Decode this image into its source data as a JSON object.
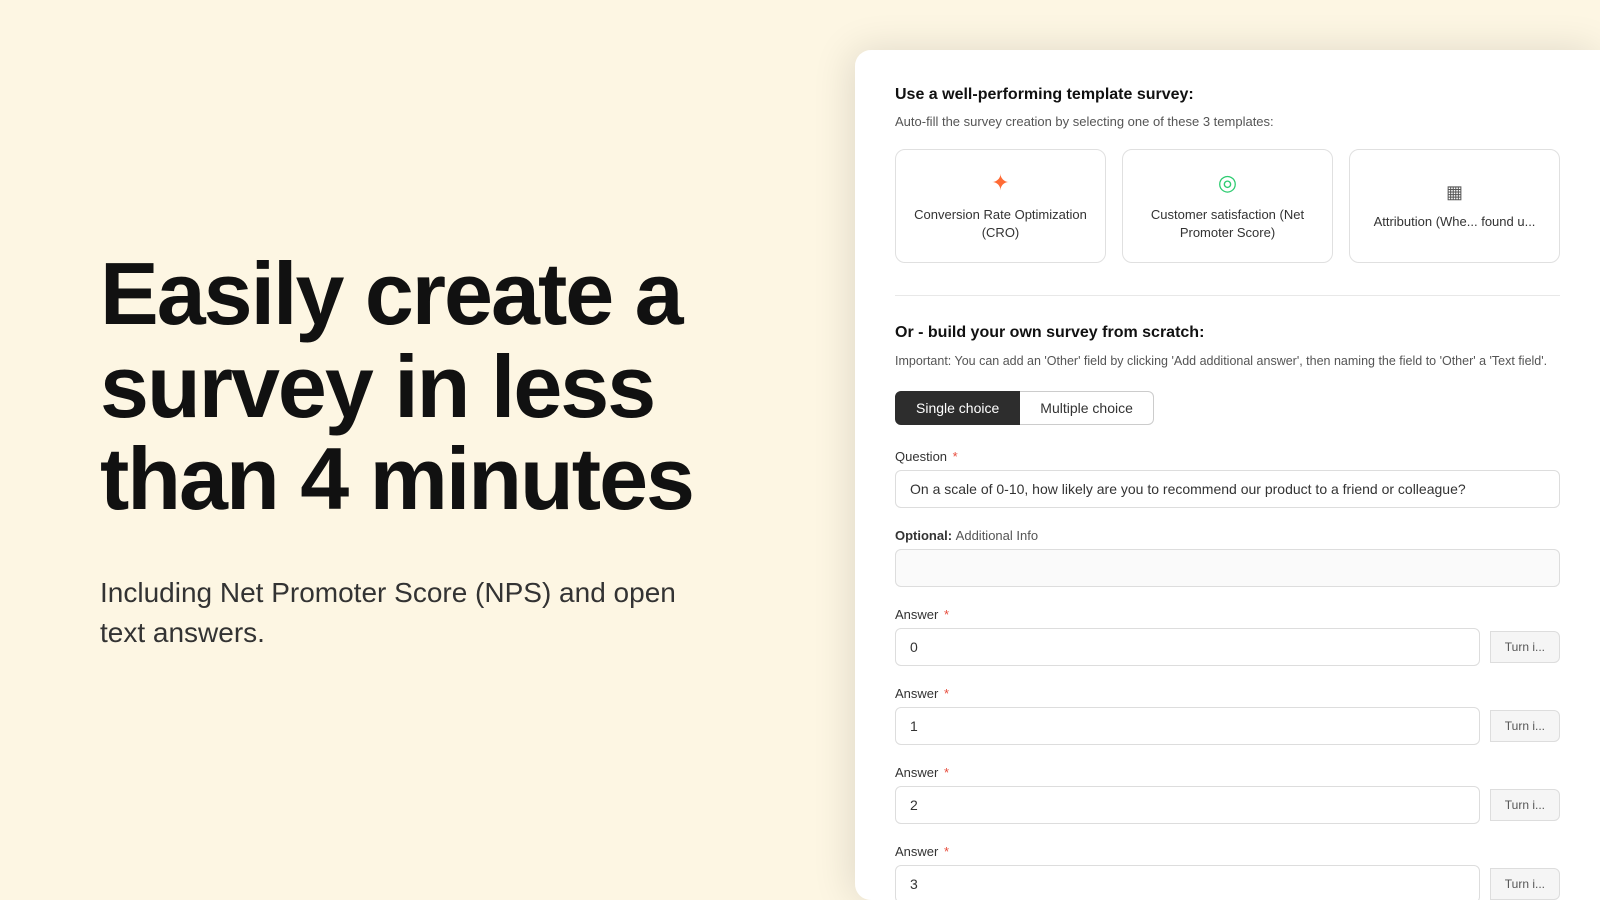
{
  "left": {
    "title": "Easily create a survey in less than 4 minutes",
    "subtitle": "Including Net Promoter Score (NPS) and open text answers."
  },
  "right": {
    "template_section_title": "Use a well-performing template survey:",
    "template_section_subtitle": "Auto-fill the survey creation by selecting one of these 3 templates:",
    "templates": [
      {
        "icon": "✦",
        "icon_type": "orange",
        "label": "Conversion Rate Optimization (CRO)"
      },
      {
        "icon": "◎",
        "icon_type": "green",
        "label": "Customer satisfaction (Net Promoter Score)"
      },
      {
        "icon": "▦",
        "icon_type": "bar",
        "label": "Attribution (Whe... found u..."
      }
    ],
    "scratch_title": "Or - build your own survey from scratch:",
    "scratch_note": "Important: You can add an 'Other' field by clicking 'Add additional answer', then naming the field to 'Other' a 'Text field'.",
    "toggle": {
      "single_label": "Single choice",
      "multiple_label": "Multiple choice",
      "active": "single"
    },
    "question_label": "Question",
    "question_placeholder": "On a scale of 0-10, how likely are you to recommend our product to a friend or colleague?",
    "optional_label": "Optional:",
    "optional_sub": "Additional Info",
    "answers": [
      {
        "label": "Answer",
        "value": "0",
        "turn_in": "Turn i..."
      },
      {
        "label": "Answer",
        "value": "1",
        "turn_in": "Turn i..."
      },
      {
        "label": "Answer",
        "value": "2",
        "turn_in": "Turn i..."
      },
      {
        "label": "Answer",
        "value": "3",
        "turn_in": "Turn i..."
      }
    ]
  }
}
